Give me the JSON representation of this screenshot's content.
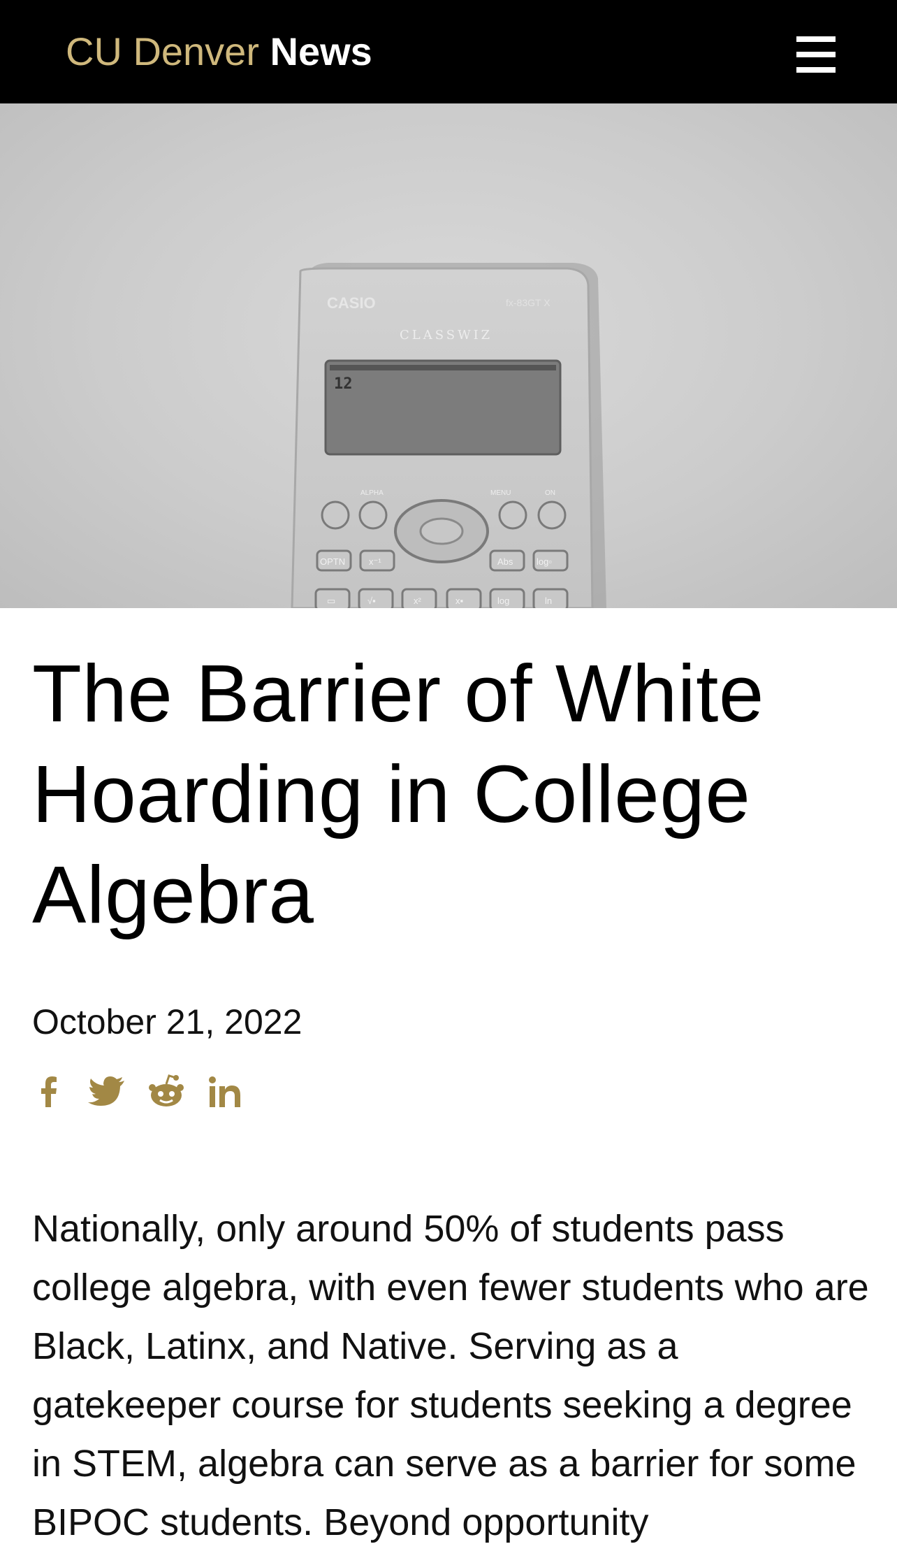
{
  "header": {
    "brand_prefix": "CU Denver",
    "brand_suffix": "News",
    "menu_icon": "hamburger-menu-icon"
  },
  "hero": {
    "alt": "Casio CLASSWIZ fx-83GTX calculator",
    "calculator_brand": "CASIO",
    "calculator_model": "fx-83GT X",
    "calculator_line": "CLASSWIZ",
    "display_value": "12",
    "keys_top": [
      "ALPHA",
      "MENU",
      "ON"
    ],
    "keys_row1": [
      "OPTN",
      "x⁻¹",
      "Abs",
      "log▫"
    ],
    "keys_row2": [
      "▭",
      "√▪",
      "x²",
      "x▪",
      "log",
      "ln"
    ]
  },
  "article": {
    "title": "The Barrier of White Hoarding in College Algebra",
    "date": "October 21, 2022",
    "body": "Nationally, only around 50% of students pass college algebra, with even fewer students who are Black, Latinx, and Native. Serving as a gatekeeper course for students seeking a degree in STEM, algebra can serve as a barrier for some BIPOC students. Beyond opportunity"
  },
  "share": {
    "icons": [
      "facebook-icon",
      "twitter-icon",
      "reddit-icon",
      "linkedin-icon"
    ],
    "color": "#a28845"
  },
  "colors": {
    "header_bg": "#000000",
    "brand_gold": "#cfb87c",
    "share_gold": "#a28845"
  }
}
